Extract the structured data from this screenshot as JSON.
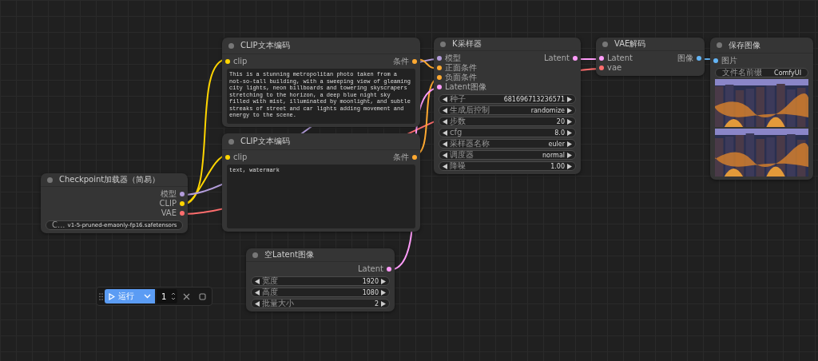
{
  "nodes": [
    {
      "title": "CLIP文本编码",
      "inputs": [
        {
          "label": "clip",
          "color": "#ffd500"
        }
      ],
      "outputs": [
        {
          "label": "条件",
          "color": "#ffa931"
        }
      ],
      "widgets": [
        {
          "kind": "textarea",
          "value": "This is a stunning metropolitan photo taken from a not-so-tall building, with a sweeping view of gleaming city lights, neon billboards and towering skyscrapers stretching to the horizon, a deep blue night sky filled with mist, illuminated by moonlight, and subtle streaks of street and car lights adding movement and energy to the scene."
        }
      ]
    },
    {
      "title": "CLIP文本编码",
      "inputs": [
        {
          "label": "clip",
          "color": "#ffd500"
        }
      ],
      "outputs": [
        {
          "label": "条件",
          "color": "#ffa931"
        }
      ],
      "widgets": [
        {
          "kind": "textarea",
          "value": "text, watermark"
        }
      ]
    },
    {
      "title": "K采样器",
      "inputs": [
        {
          "label": "模型",
          "color": "#b39ddb"
        },
        {
          "label": "正面条件",
          "color": "#ffa931"
        },
        {
          "label": "负面条件",
          "color": "#ffa931"
        },
        {
          "label": "Latent图像",
          "color": "#ff9cf9"
        }
      ],
      "outputs": [
        {
          "label": "Latent",
          "color": "#ff9cf9"
        }
      ],
      "widgets": [
        {
          "kind": "number",
          "label": "种子",
          "value": "681696713236571"
        },
        {
          "kind": "combo",
          "label": "生成后控制",
          "value": "randomize"
        },
        {
          "kind": "number",
          "label": "步数",
          "value": "20"
        },
        {
          "kind": "number",
          "label": "cfg",
          "value": "8.0"
        },
        {
          "kind": "combo",
          "label": "采样器名称",
          "value": "euler"
        },
        {
          "kind": "combo",
          "label": "调度器",
          "value": "normal"
        },
        {
          "kind": "number",
          "label": "降噪",
          "value": "1.00"
        }
      ]
    },
    {
      "title": "VAE解码",
      "inputs": [
        {
          "label": "Latent",
          "color": "#ff9cf9"
        },
        {
          "label": "vae",
          "color": "#ff6e6e"
        }
      ],
      "outputs": [
        {
          "label": "图像",
          "color": "#64b5f6"
        }
      ]
    },
    {
      "title": "保存图像",
      "inputs": [
        {
          "label": "图片",
          "color": "#64b5f6"
        }
      ],
      "widgets": [
        {
          "kind": "text",
          "label": "文件名前缀",
          "value": "ComfyUI"
        },
        {
          "kind": "picture"
        },
        {
          "kind": "picture"
        }
      ]
    },
    {
      "title": "Checkpoint加载器（简易）",
      "outputs": [
        {
          "label": "模型",
          "color": "#b39ddb"
        },
        {
          "label": "CLIP",
          "color": "#ffd500"
        },
        {
          "label": "VAE",
          "color": "#ff6e6e"
        }
      ],
      "widgets": [
        {
          "kind": "combo",
          "label": "C...",
          "value": "v1-5-pruned-emaonly-fp16.safetensors"
        }
      ]
    },
    {
      "title": "空Latent图像",
      "outputs": [
        {
          "label": "Latent",
          "color": "#ff9cf9"
        }
      ],
      "widgets": [
        {
          "kind": "number",
          "label": "宽度",
          "value": "1920"
        },
        {
          "kind": "number",
          "label": "高度",
          "value": "1080"
        },
        {
          "kind": "number",
          "label": "批量大小",
          "value": "2"
        }
      ]
    }
  ],
  "toolbar": {
    "run_label": "运行",
    "count": "1"
  }
}
